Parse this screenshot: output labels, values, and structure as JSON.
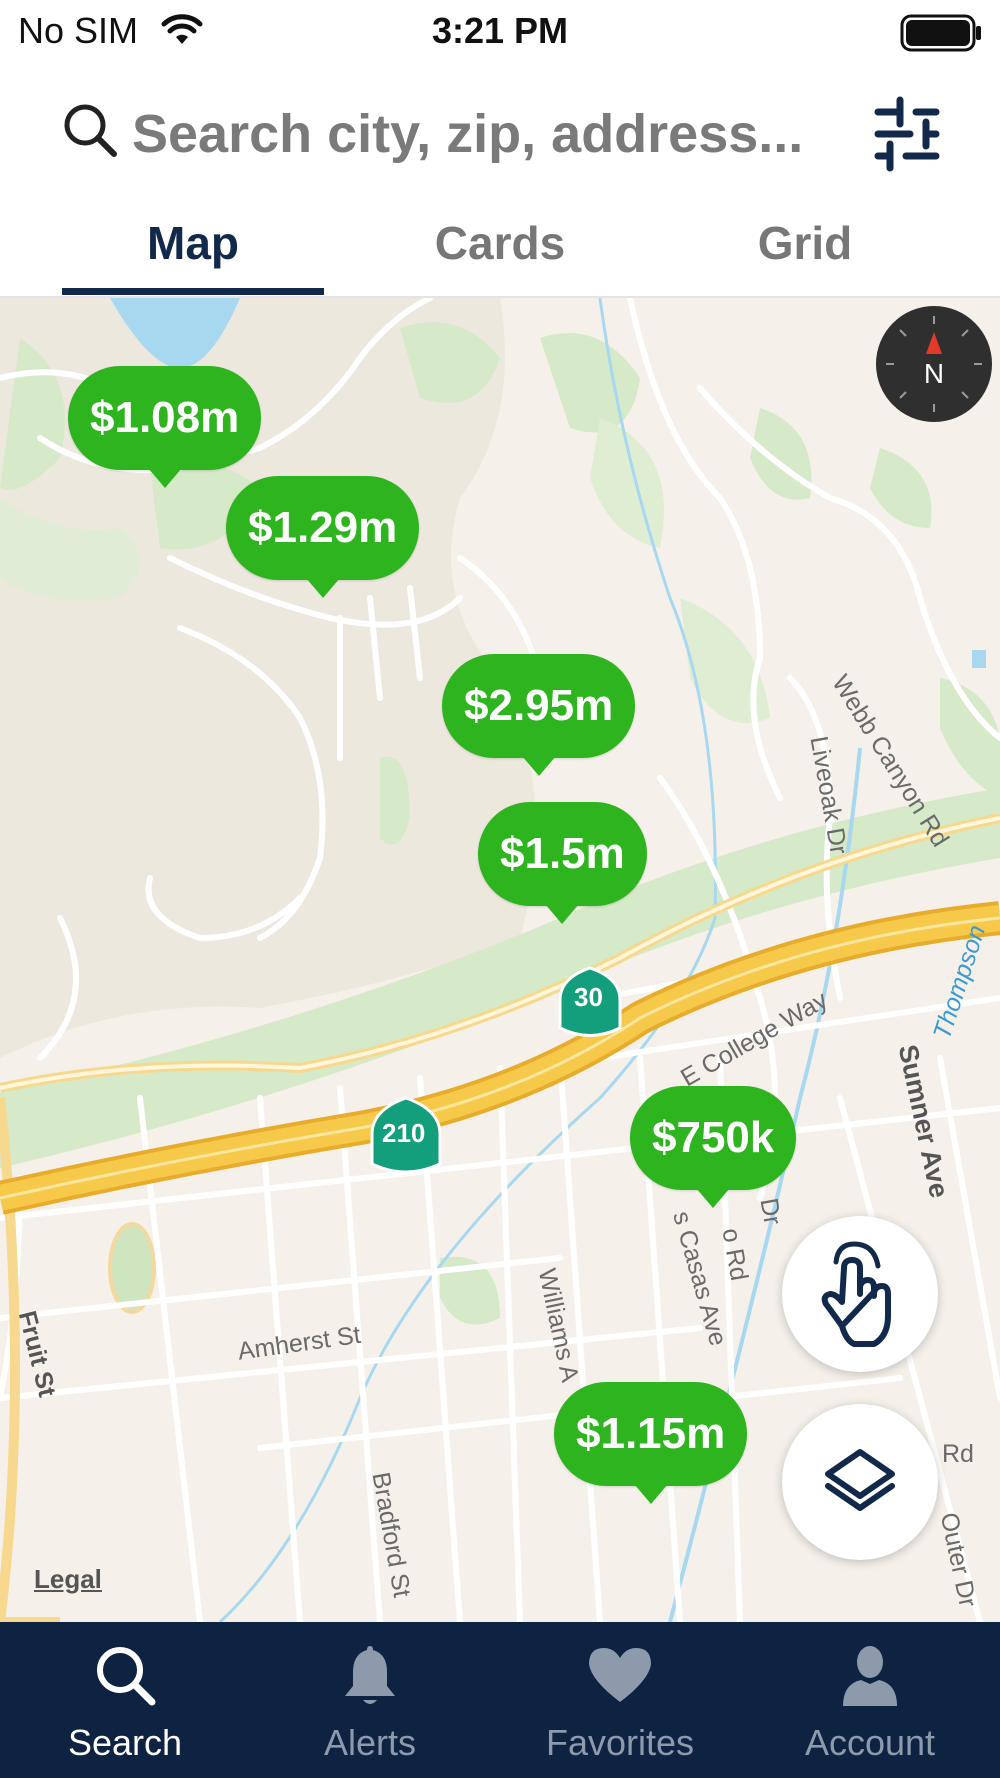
{
  "status_bar": {
    "carrier": "No SIM",
    "time": "3:21 PM"
  },
  "search": {
    "placeholder": "Search city, zip, address..."
  },
  "tabs": [
    {
      "label": "Map",
      "active": true
    },
    {
      "label": "Cards",
      "active": false
    },
    {
      "label": "Grid",
      "active": false
    }
  ],
  "map": {
    "pins": [
      {
        "price": "$1.08m"
      },
      {
        "price": "$1.29m"
      },
      {
        "price": "$2.95m"
      },
      {
        "price": "$1.5m"
      },
      {
        "price": "$750k"
      },
      {
        "price": "$1.15m"
      }
    ],
    "street_labels": {
      "webb_canyon": "Webb Canyon Rd",
      "liveoak": "Liveoak Dr",
      "thompson": "Thompson",
      "sumner": "Sumner Ave",
      "college": "E College Way",
      "casas": "s Casas Ave",
      "o_rd": "o Rd",
      "dr": "Dr",
      "williams": "Williams A",
      "amherst": "Amherst St",
      "fruit": "Fruit St",
      "bradford": "Bradford St",
      "rd": "Rd",
      "outer_dr": "Outer Dr"
    },
    "highway_shields": {
      "route_30": "30",
      "route_210": "210"
    },
    "compass_letter": "N",
    "legal": "Legal",
    "colors": {
      "pin": "#2eb41f",
      "land": "#f5f1ea",
      "park": "#d6e9c8",
      "highway": "#f6c94a",
      "water": "#a8d8f0"
    }
  },
  "bottom_nav": [
    {
      "label": "Search",
      "icon": "search-icon",
      "active": true
    },
    {
      "label": "Alerts",
      "icon": "bell-icon",
      "active": false
    },
    {
      "label": "Favorites",
      "icon": "heart-icon",
      "active": false
    },
    {
      "label": "Account",
      "icon": "person-icon",
      "active": false
    }
  ],
  "colors": {
    "navy": "#13294b",
    "nav_bg": "#0e2241"
  }
}
